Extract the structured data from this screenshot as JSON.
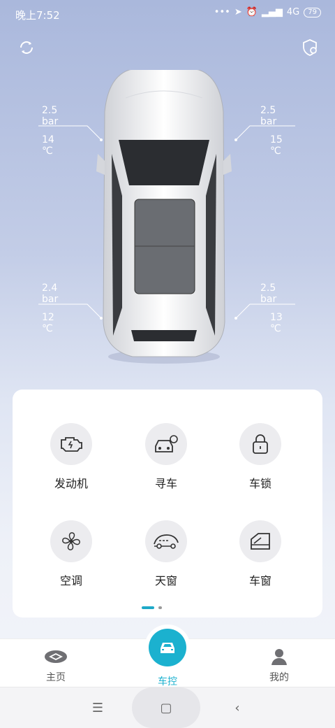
{
  "status_bar": {
    "time": "晚上7:52",
    "network": "4G",
    "battery": "79"
  },
  "top_icons": {
    "refresh": "refresh-icon",
    "settings": "shield-gear-icon"
  },
  "tires": {
    "front_left": {
      "pressure": "2.5 bar",
      "temp": "14 ℃"
    },
    "front_right": {
      "pressure": "2.5 bar",
      "temp": "15 ℃"
    },
    "rear_left": {
      "pressure": "2.4 bar",
      "temp": "12 ℃"
    },
    "rear_right": {
      "pressure": "2.5 bar",
      "temp": "13 ℃"
    }
  },
  "controls": [
    {
      "label": "发动机",
      "icon": "engine-icon"
    },
    {
      "label": "寻车",
      "icon": "find-car-icon"
    },
    {
      "label": "车锁",
      "icon": "lock-icon"
    },
    {
      "label": "空调",
      "icon": "fan-icon"
    },
    {
      "label": "天窗",
      "icon": "sunroof-icon"
    },
    {
      "label": "车窗",
      "icon": "window-icon"
    }
  ],
  "tabs": {
    "home": "主页",
    "car_control": "车控",
    "mine": "我的"
  },
  "colors": {
    "accent": "#1bb1cf",
    "background_top": "#aab8dc"
  }
}
